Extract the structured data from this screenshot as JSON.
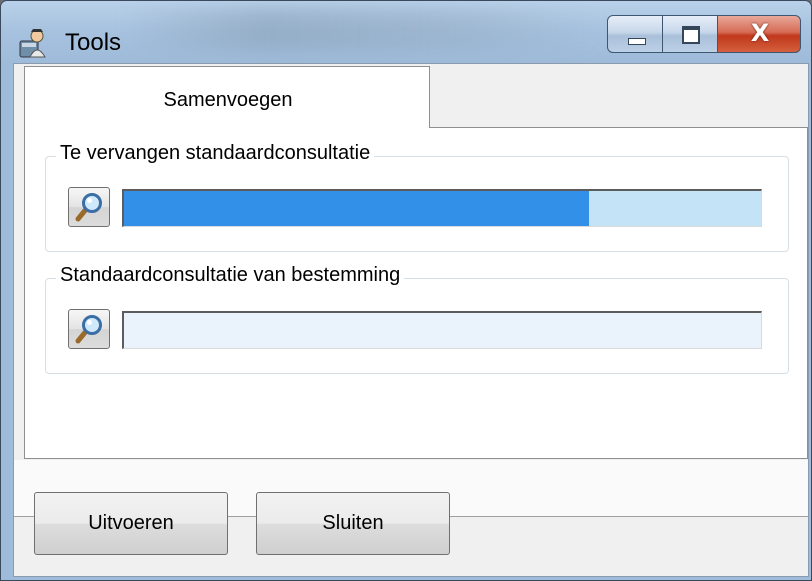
{
  "window": {
    "title": "Tools",
    "icon": "tools-app-icon",
    "controls": {
      "minimize": "minimize-icon",
      "maximize": "maximize-icon",
      "close": "X"
    }
  },
  "tabs": [
    {
      "label": "Samenvoegen",
      "active": true
    }
  ],
  "groups": {
    "source": {
      "legend": "Te vervangen standaardconsultatie",
      "search_icon": "magnifier-icon",
      "field_value": "",
      "selection_fraction": 0.73
    },
    "target": {
      "legend": "Standaardconsultatie van bestemming",
      "search_icon": "magnifier-icon",
      "field_value": ""
    }
  },
  "buttons": {
    "run": "Uitvoeren",
    "close": "Sluiten"
  },
  "colors": {
    "selection": "#3390e8",
    "field_highlight": "#c4e3f7",
    "field_idle": "#eaf3fb",
    "close_button": "#c0381c"
  }
}
